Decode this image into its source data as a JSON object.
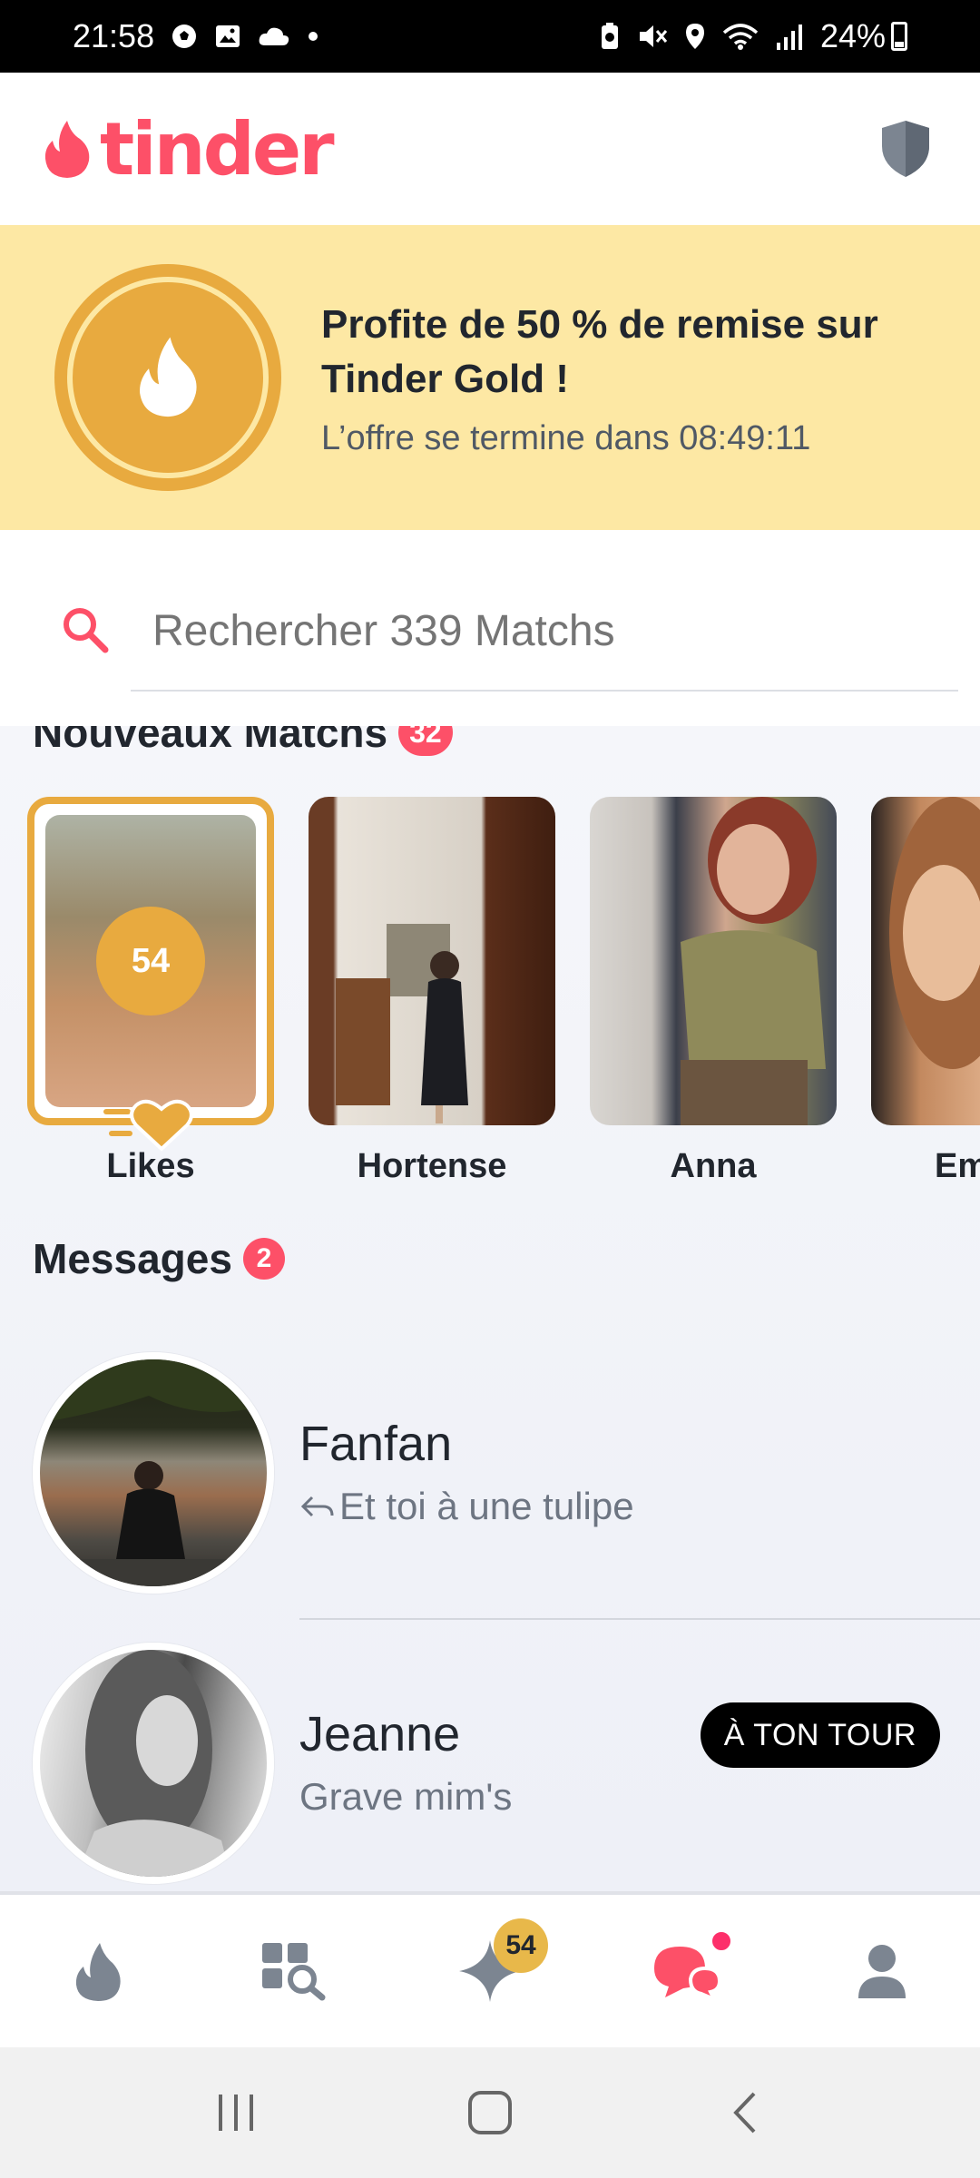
{
  "status_bar": {
    "time": "21:58",
    "battery": "24%"
  },
  "header": {
    "logo_text": "tinder",
    "shield_icon": "shield-icon"
  },
  "gold_banner": {
    "title": "Profite de 50 % de remise sur Tinder Gold !",
    "subtitle": "L’offre se termine dans 08:49:11",
    "color": "#e8aa3f",
    "background": "#fde8a4"
  },
  "search": {
    "placeholder": "Rechercher 339 Matchs"
  },
  "new_matches": {
    "title": "Nouveaux Matchs",
    "count": "32",
    "likes": {
      "count": "54",
      "label": "Likes"
    },
    "items": [
      {
        "name": "Hortense"
      },
      {
        "name": "Anna"
      },
      {
        "name": "Em"
      }
    ]
  },
  "messages": {
    "title": "Messages",
    "count": "2",
    "items": [
      {
        "name": "Fanfan",
        "preview": "Et toi à une tulipe",
        "replied": true
      },
      {
        "name": "Jeanne",
        "preview": "Grave mim's",
        "badge": "À TON TOUR"
      }
    ]
  },
  "bottom_nav": {
    "items": [
      {
        "icon": "flame-icon"
      },
      {
        "icon": "explore-icon"
      },
      {
        "icon": "sparkle-icon",
        "badge": "54"
      },
      {
        "icon": "chat-icon",
        "active": true
      },
      {
        "icon": "profile-icon"
      }
    ]
  },
  "colors": {
    "brand": "#fd5068",
    "gold": "#e8aa3f",
    "nav_inactive": "#7c8591"
  }
}
